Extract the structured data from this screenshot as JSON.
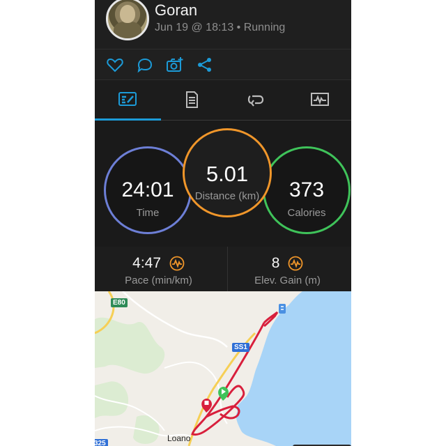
{
  "profile": {
    "name": "Goran",
    "meta": "Jun 19 @ 18:13 • Running"
  },
  "actions": {
    "icons": [
      "heart-icon",
      "comment-icon",
      "add-photo-icon",
      "share-icon"
    ]
  },
  "tabs": {
    "icons": [
      "stats-icon",
      "details-icon",
      "laps-icon",
      "chart-icon"
    ],
    "active": 0
  },
  "stats": {
    "time": {
      "value": "24:01",
      "label": "Time"
    },
    "distance": {
      "value": "5.01",
      "label": "Distance (km)"
    },
    "calories": {
      "value": "373",
      "label": "Calories"
    }
  },
  "metrics": {
    "pace": {
      "value": "4:47",
      "label": "Pace (min/km)"
    },
    "elevation": {
      "value": "8",
      "label": "Elev. Gain (m)"
    }
  },
  "map": {
    "road_e80": "E80",
    "road_ss1": "SS1",
    "road_partial": "325",
    "town": "Loano"
  },
  "colors": {
    "accent": "#1c9bd8",
    "time_ring": "#6d7fd6",
    "distance_ring": "#f0962a",
    "calories_ring": "#3fc35a",
    "route": "#d81f3c"
  }
}
